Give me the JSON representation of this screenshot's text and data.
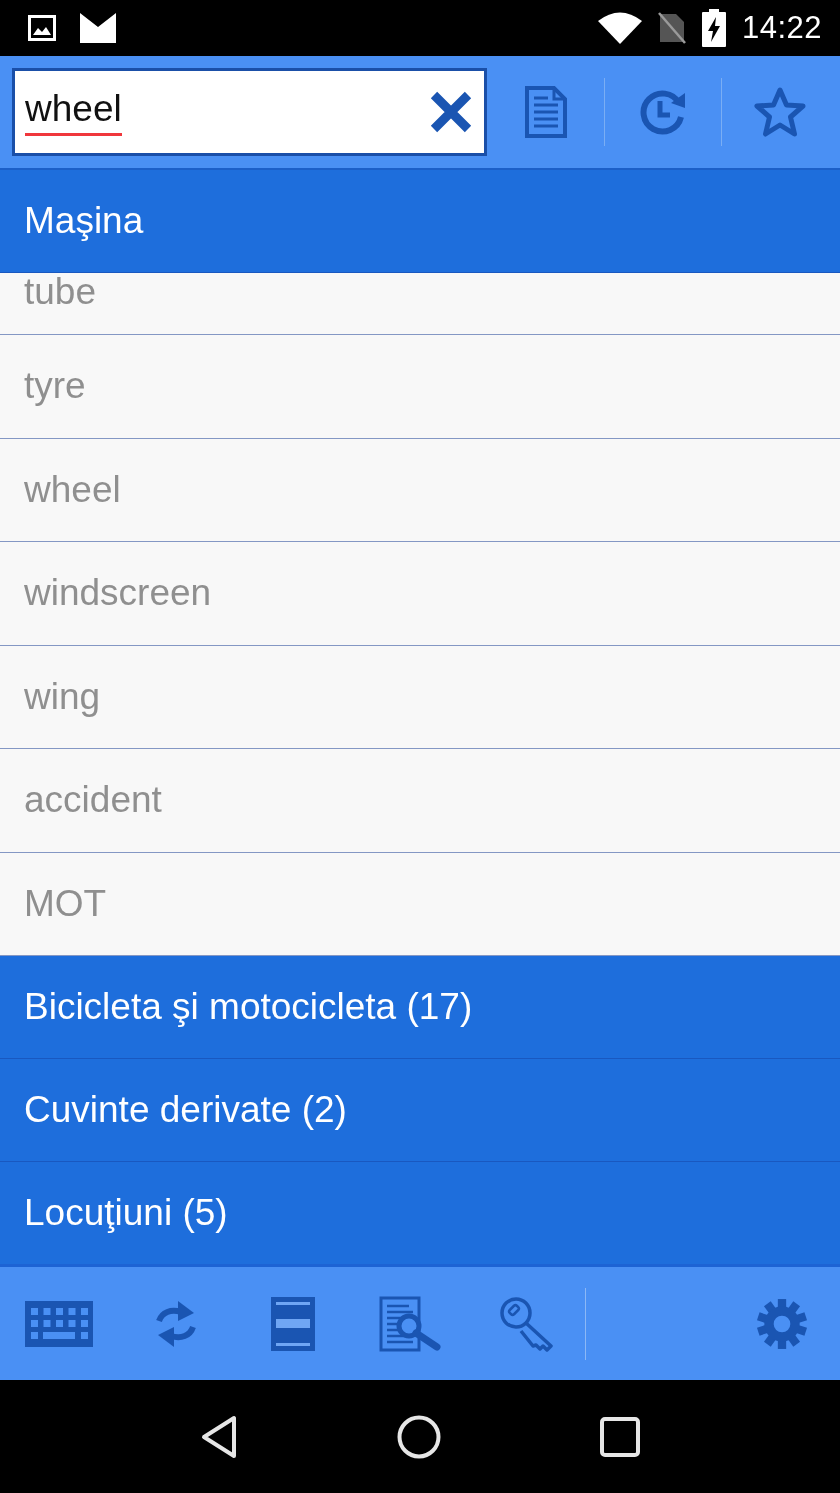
{
  "status_bar": {
    "time": "14:22"
  },
  "search": {
    "value": "wheel",
    "spelling_error": true
  },
  "sections": [
    {
      "title": "Maşina",
      "items": [
        {
          "label": "tube",
          "kind": "partial"
        },
        {
          "label": "tyre",
          "kind": "full"
        },
        {
          "label": "wheel",
          "kind": "full"
        },
        {
          "label": "windscreen",
          "kind": "full"
        },
        {
          "label": "wing",
          "kind": "full"
        },
        {
          "label": "accident",
          "kind": "full"
        },
        {
          "label": "MOT",
          "kind": "full"
        }
      ]
    },
    {
      "title": "Bicicleta şi motocicleta (17)"
    },
    {
      "title": "Cuvinte derivate (2)"
    },
    {
      "title": "Locuţiuni (5)"
    }
  ]
}
